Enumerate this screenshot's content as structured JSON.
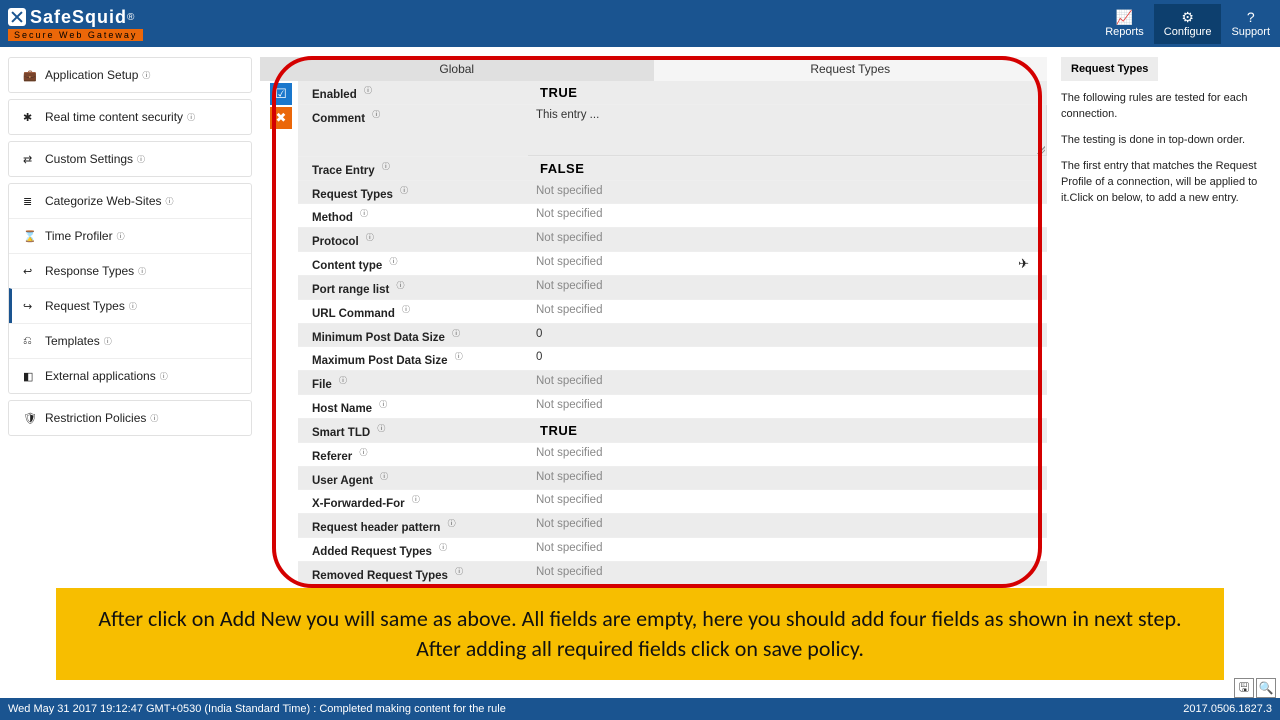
{
  "brand": {
    "name": "SafeSquid",
    "reg": "®",
    "tagline": "Secure Web Gateway"
  },
  "header": {
    "items": [
      {
        "icon": "📈",
        "label": "Reports"
      },
      {
        "icon": "⚙",
        "label": "Configure",
        "active": true
      },
      {
        "icon": "?",
        "label": "Support"
      }
    ]
  },
  "sidebar": {
    "groups": [
      {
        "items": [
          {
            "icon": "💼",
            "label": "Application Setup",
            "parent": true
          }
        ]
      },
      {
        "items": [
          {
            "icon": "✱",
            "label": "Real time content security",
            "parent": true
          }
        ]
      },
      {
        "items": [
          {
            "icon": "⇄",
            "label": "Custom Settings",
            "parent": true
          }
        ]
      },
      {
        "items": [
          {
            "icon": "≣",
            "label": "Categorize Web-Sites"
          },
          {
            "icon": "⌛",
            "label": "Time Profiler"
          },
          {
            "icon": "↩",
            "label": "Response Types"
          },
          {
            "icon": "↪",
            "label": "Request Types",
            "active": true
          },
          {
            "icon": "⎌",
            "label": "Templates"
          },
          {
            "icon": "◧",
            "label": "External applications"
          }
        ]
      },
      {
        "items": [
          {
            "icon": "🛡",
            "label": "Restriction Policies",
            "parent": true
          }
        ]
      }
    ]
  },
  "tabs": [
    {
      "label": "Global",
      "active": false,
      "shaded": true
    },
    {
      "label": "Request Types",
      "active": true,
      "shaded": false
    }
  ],
  "form": {
    "rows": [
      {
        "label": "Enabled",
        "value": "TRUE",
        "bold": true,
        "shade": true
      },
      {
        "label": "Comment",
        "value": "This entry ...",
        "shade": true,
        "comment": true
      },
      {
        "label": "Trace Entry",
        "value": "FALSE",
        "bold": true,
        "shade": true
      },
      {
        "label": "Request Types",
        "value": "Not specified",
        "placeholder": true,
        "shade": true
      },
      {
        "label": "Method",
        "value": "Not specified",
        "placeholder": true
      },
      {
        "label": "Protocol",
        "value": "Not specified",
        "placeholder": true,
        "shade": true
      },
      {
        "label": "Content type",
        "value": "Not specified",
        "placeholder": true,
        "send": true
      },
      {
        "label": "Port range list",
        "value": "Not specified",
        "placeholder": true,
        "shade": true
      },
      {
        "label": "URL Command",
        "value": "Not specified",
        "placeholder": true
      },
      {
        "label": "Minimum Post Data Size",
        "value": "0",
        "shade": true
      },
      {
        "label": "Maximum Post Data Size",
        "value": "0"
      },
      {
        "label": "File",
        "value": "Not specified",
        "placeholder": true,
        "shade": true
      },
      {
        "label": "Host Name",
        "value": "Not specified",
        "placeholder": true
      },
      {
        "label": "Smart TLD",
        "value": "TRUE",
        "bold": true,
        "shade": true
      },
      {
        "label": "Referer",
        "value": "Not specified",
        "placeholder": true
      },
      {
        "label": "User Agent",
        "value": "Not specified",
        "placeholder": true,
        "shade": true
      },
      {
        "label": "X-Forwarded-For",
        "value": "Not specified",
        "placeholder": true
      },
      {
        "label": "Request header pattern",
        "value": "Not specified",
        "placeholder": true,
        "shade": true
      },
      {
        "label": "Added Request Types",
        "value": "Not specified",
        "placeholder": true
      },
      {
        "label": "Removed Request Types",
        "value": "Not specified",
        "placeholder": true,
        "shade": true
      }
    ]
  },
  "info_panel": {
    "title": "Request Types",
    "paras": [
      "The following rules are tested for each connection.",
      "The testing is done in top-down order.",
      "The first entry that matches the Request Profile of a connection, will be applied to it.Click on below, to add a new entry."
    ]
  },
  "annotation": "After click on Add New you will same as above. All fields are empty, here you should add four fields as shown in next step. After adding all required fields click on save policy.",
  "footer": {
    "status": "Wed May 31 2017 19:12:47 GMT+0530 (India Standard Time) : Completed making content for the rule",
    "build": "2017.0506.1827.3"
  }
}
